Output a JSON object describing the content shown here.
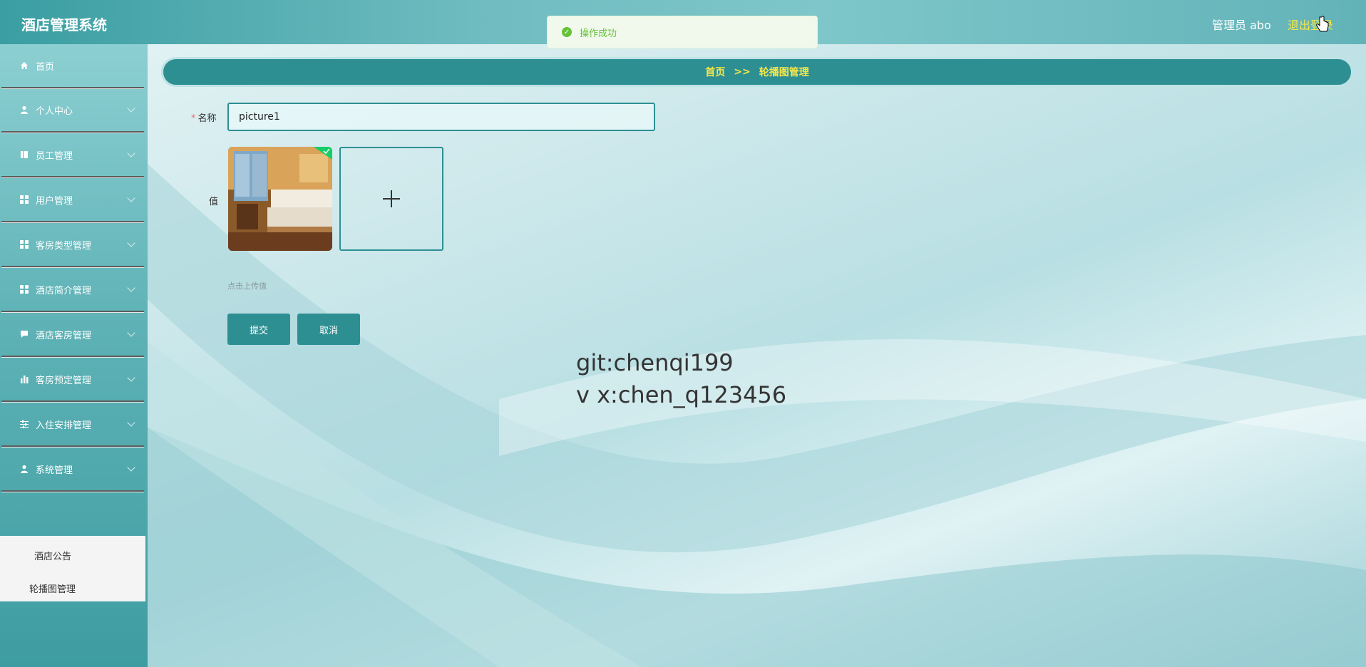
{
  "app": {
    "title": "酒店管理系统"
  },
  "header": {
    "admin_label": "管理员 abo",
    "logout_label": "退出登录"
  },
  "toast": {
    "message": "操作成功",
    "type": "success"
  },
  "sidebar": {
    "items": [
      {
        "label": "首页",
        "icon": "home-icon"
      },
      {
        "label": "个人中心",
        "icon": "user-icon"
      },
      {
        "label": "员工管理",
        "icon": "staff-icon"
      },
      {
        "label": "用户管理",
        "icon": "grid-icon"
      },
      {
        "label": "客房类型管理",
        "icon": "grid-icon"
      },
      {
        "label": "酒店简介管理",
        "icon": "grid-icon"
      },
      {
        "label": "酒店客房管理",
        "icon": "chat-icon"
      },
      {
        "label": "客房预定管理",
        "icon": "bar-chart-icon"
      },
      {
        "label": "入住安排管理",
        "icon": "sliders-icon"
      },
      {
        "label": "系统管理",
        "icon": "user-icon"
      }
    ],
    "submenu": [
      {
        "label": "酒店公告"
      },
      {
        "label": "轮播图管理"
      }
    ]
  },
  "breadcrumb": {
    "home": "首页",
    "separator": ">>",
    "current": "轮播图管理"
  },
  "form": {
    "name_label": "名称",
    "name_required_mark": "*",
    "name_value": "picture1",
    "value_label": "值",
    "upload_hint": "点击上传值",
    "submit_label": "提交",
    "cancel_label": "取消"
  },
  "watermark": {
    "line1": "git:chenqi199",
    "line2": "v x:chen_q123456"
  },
  "colors": {
    "accent": "#2e8f93",
    "highlight": "#f5e74a",
    "success": "#67c23a"
  }
}
